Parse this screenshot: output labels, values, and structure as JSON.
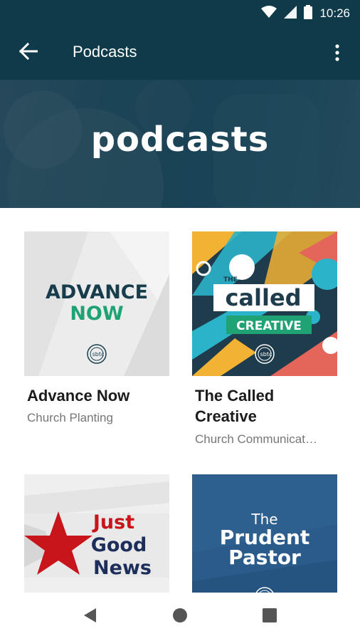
{
  "status_bar": {
    "time": "10:26",
    "icons": [
      "wifi-icon",
      "signal-icon",
      "battery-icon"
    ]
  },
  "app_bar": {
    "title": "Podcasts",
    "back_icon": "back-arrow-icon",
    "menu_icon": "more-vert-icon"
  },
  "hero": {
    "title": "podcasts"
  },
  "podcasts": [
    {
      "title": "Advance Now",
      "category": "Church Planting",
      "art_lines": [
        "ADVANCE",
        "NOW"
      ],
      "logo": "sbtc"
    },
    {
      "title": "The Called Creative",
      "category": "Church Communicat…",
      "art_lines": [
        "THE",
        "called",
        "CREATIVE"
      ],
      "logo": "sbtc"
    },
    {
      "title": "",
      "category": "",
      "art_lines": [
        "Just",
        "Good",
        "News"
      ]
    },
    {
      "title": "",
      "category": "",
      "art_lines": [
        "The",
        "Prudent",
        "Pastor"
      ]
    }
  ],
  "nav_bar": {
    "icons": [
      "back-triangle-icon",
      "home-circle-icon",
      "recents-square-icon"
    ]
  },
  "colors": {
    "app_bar": "#0f3a4a",
    "hero": "#1f4759",
    "advance_dark": "#173d4c",
    "advance_green": "#1fa374",
    "just_red": "#c8151b",
    "just_navy": "#1d2e5a",
    "prudent_blue": "#2a5b8a"
  }
}
